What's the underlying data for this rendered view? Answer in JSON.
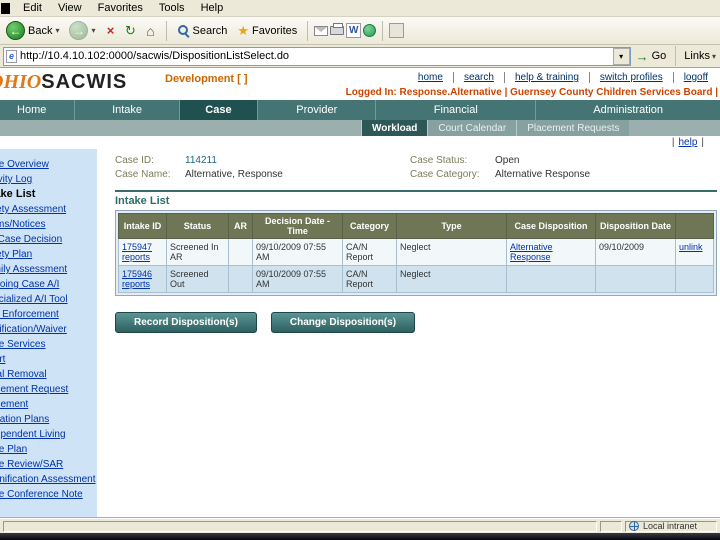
{
  "browser": {
    "menu_items": [
      "Edit",
      "View",
      "Favorites",
      "Tools",
      "Help"
    ],
    "back_label": "Back",
    "search_label": "Search",
    "favorites_label": "Favorites",
    "word_icon_letter": "W",
    "url": "http://10.4.10.102:0000/sacwis/DispositionListSelect.do",
    "go_label": "Go",
    "links_label": "Links",
    "status_zone": "Local intranet"
  },
  "header": {
    "logo_ohio": "OHIO",
    "logo_sacwis": "SACWIS",
    "environment": "Development [ ]",
    "links": [
      "home",
      "search",
      "help & training",
      "switch profiles",
      "logoff"
    ],
    "logged_in": "Logged In:  Response.Alternative | Guernsey County Children Services Board |"
  },
  "nav": {
    "tabs": [
      "Home",
      "Intake",
      "Case",
      "Provider",
      "Financial",
      "Administration"
    ],
    "selected_tab": "Case",
    "subtabs": [
      "Workload",
      "Court Calendar",
      "Placement Requests"
    ],
    "selected_subtab": "Workload",
    "help_link": "help"
  },
  "sidebar": {
    "current_item": "Intake List",
    "items": [
      "Case Overview",
      "Activity Log",
      "Intake List",
      "Safety Assessment",
      "Forms/Notices",
      "AR Case Decision",
      "Safety Plan",
      "Family Assessment",
      "Ongoing Case A/I",
      "Specialized A/I Tool",
      "Law Enforcement",
      "Justification/Waiver",
      "Case Services",
      "Court",
      "Initial Removal",
      "Placement Request",
      "Placement",
      "Visitation Plans",
      "Independent Living",
      "Case Plan",
      "Case Review/SAR",
      "Reunification Assessment",
      "Case Conference Note"
    ]
  },
  "case_info": {
    "case_id_label": "Case ID:",
    "case_id": "114211",
    "case_name_label": "Case Name:",
    "case_name": "Alternative, Response",
    "case_status_label": "Case Status:",
    "case_status": "Open",
    "case_category_label": "Case Category:",
    "case_category": "Alternative Response"
  },
  "intake_list": {
    "title": "Intake List",
    "columns": [
      "Intake ID",
      "Status",
      "AR",
      "Decision Date - Time",
      "Category",
      "Type",
      "Case Disposition",
      "Disposition Date",
      ""
    ],
    "rows": [
      {
        "id": "175947",
        "id_sub": "reports",
        "status": "Screened In AR",
        "ar": "",
        "decision": "09/10/2009 07:55 AM",
        "category": "CA/N Report",
        "type": "Neglect",
        "disposition": "Alternative Response",
        "disposition_date": "09/10/2009",
        "action": "unlink"
      },
      {
        "id": "175946",
        "id_sub": "reports",
        "status": "Screened Out",
        "ar": "",
        "decision": "09/10/2009 07:55 AM",
        "category": "CA/N Report",
        "type": "Neglect",
        "disposition": "",
        "disposition_date": "",
        "action": ""
      }
    ]
  },
  "actions": {
    "record_button": "Record Disposition(s)",
    "change_button": "Change Disposition(s)"
  },
  "colors": {
    "accent_orange": "#cc6600",
    "logged_in_orange": "#cc4400",
    "nav_teal": "#447474",
    "selected_teal": "#1f5151",
    "sidebar_blue": "#cfe3f6",
    "table_header_olive": "#6e7656",
    "row_alt_blue": "#cfe2ee",
    "link_blue": "#0033aa",
    "button_teal": "#2e6060"
  }
}
